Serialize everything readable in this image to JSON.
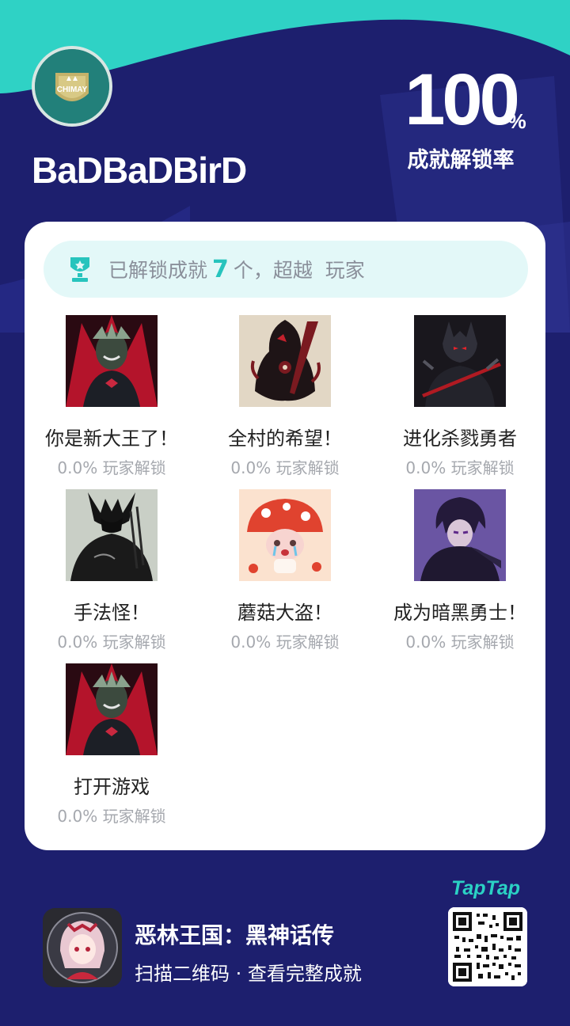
{
  "profile": {
    "username": "BaDBaDBirD",
    "avatar_label": "CHIMAY"
  },
  "completion": {
    "value": "100",
    "unit": "%",
    "label": "成就解锁率"
  },
  "summary": {
    "prefix": "已解锁成就",
    "count": "7",
    "suffix": "个，超越  玩家"
  },
  "achievements": [
    {
      "name": "你是新大王了！",
      "stat": "0.0% 玩家解锁",
      "icon": "demon-king-red-icon"
    },
    {
      "name": "全村的希望！",
      "stat": "0.0% 玩家解锁",
      "icon": "hooded-dark-knight-icon"
    },
    {
      "name": "进化杀戮勇者",
      "stat": "0.0% 玩家解锁",
      "icon": "armored-warrior-icon"
    },
    {
      "name": "手法怪！",
      "stat": "0.0% 玩家解锁",
      "icon": "dark-sorcerer-icon"
    },
    {
      "name": "蘑菇大盗！",
      "stat": "0.0% 玩家解锁",
      "icon": "crying-mushroom-girl-icon"
    },
    {
      "name": "成为暗黑勇士！",
      "stat": "0.0% 玩家解锁",
      "icon": "purple-hair-hero-icon"
    },
    {
      "name": "打开游戏",
      "stat": "0.0% 玩家解锁",
      "icon": "demon-king-red-icon"
    }
  ],
  "footer": {
    "game_title": "恶林王国：黑神话传",
    "subtitle": "扫描二维码 · 查看完整成就",
    "brand": "TapTap"
  },
  "colors": {
    "background": "#1d1f6e",
    "accent": "#27c4bd",
    "wave": "#2fd2c5"
  }
}
